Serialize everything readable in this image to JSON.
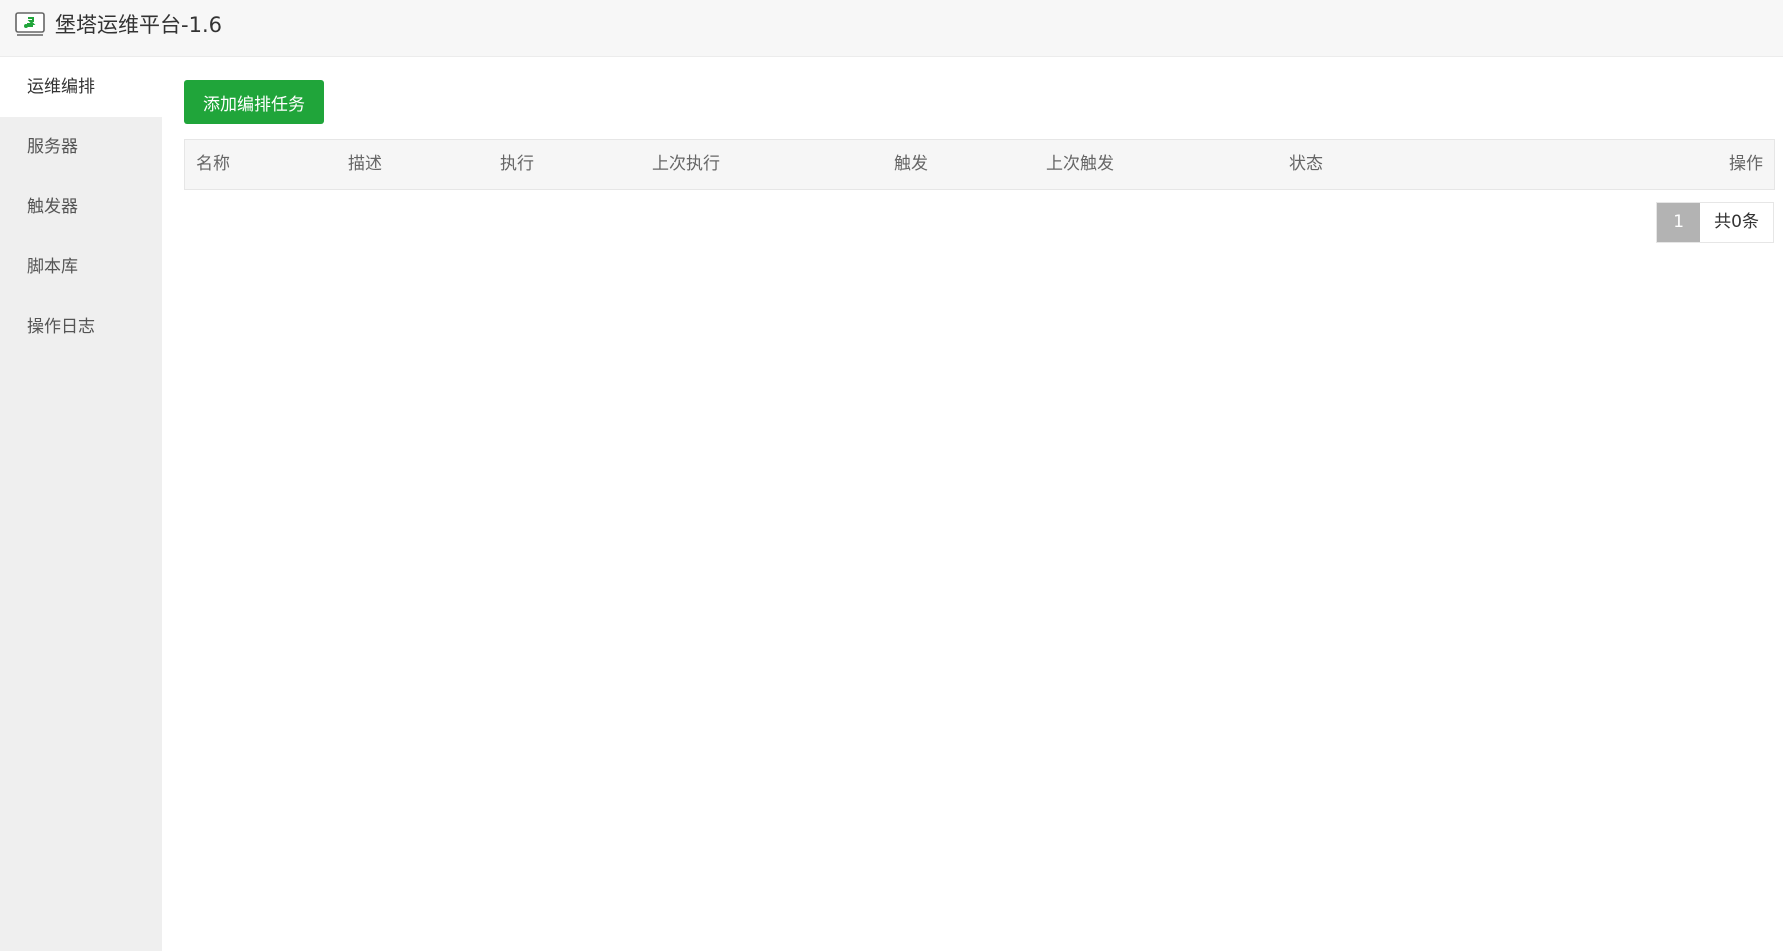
{
  "app": {
    "icon": "bt-logo-icon",
    "title": "堡塔运维平台-1.6"
  },
  "sidebar": {
    "items": [
      {
        "label": "运维编排",
        "active": true
      },
      {
        "label": "服务器",
        "active": false
      },
      {
        "label": "触发器",
        "active": false
      },
      {
        "label": "脚本库",
        "active": false
      },
      {
        "label": "操作日志",
        "active": false
      }
    ]
  },
  "toolbar": {
    "add_label": "添加编排任务"
  },
  "table": {
    "columns": [
      "名称",
      "描述",
      "执行",
      "上次执行",
      "触发",
      "上次触发",
      "状态",
      "操作"
    ],
    "rows": []
  },
  "pagination": {
    "current_page": "1",
    "total_label": "共0条"
  },
  "colors": {
    "accent": "#20a53a",
    "sidebar_bg": "#efefef",
    "header_bg": "#f7f7f7",
    "page_active_bg": "#b3b3b3"
  }
}
